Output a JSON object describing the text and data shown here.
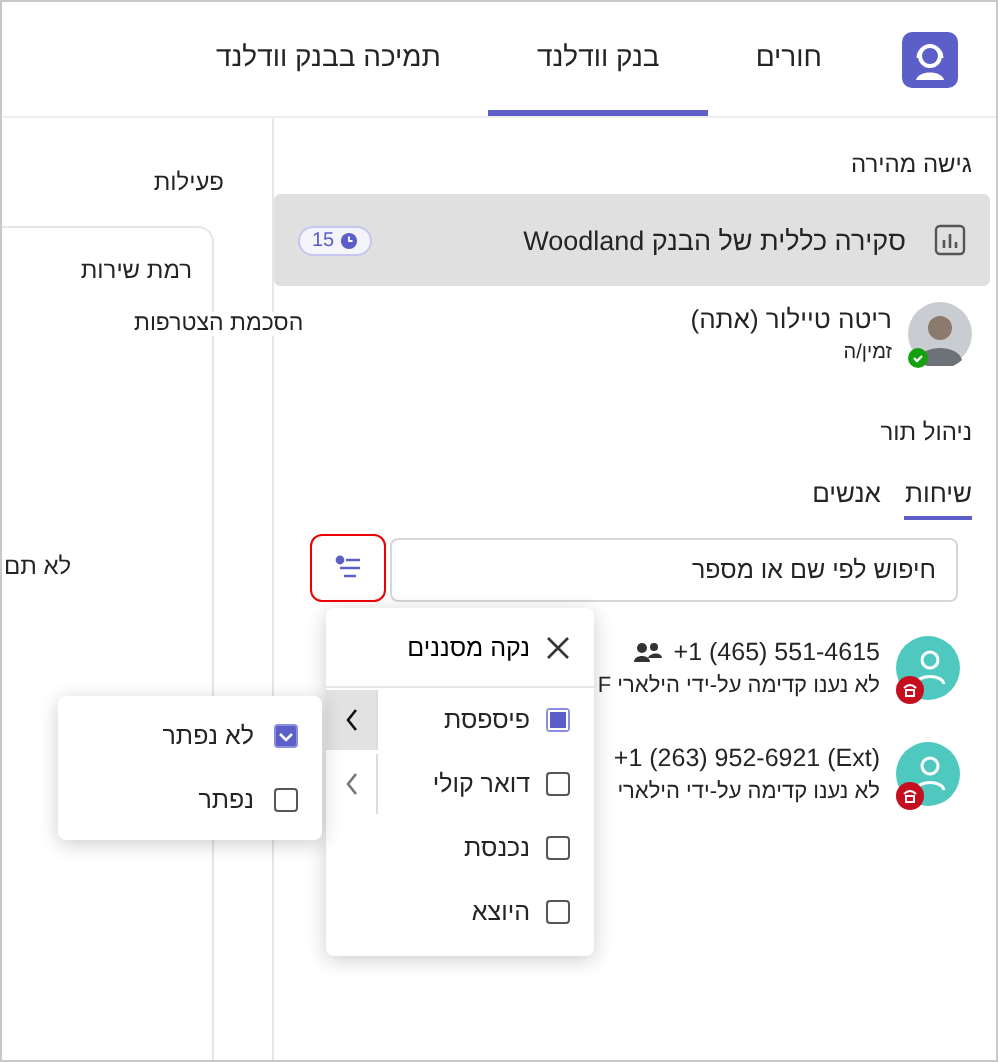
{
  "app_tabs": [
    {
      "label": "חורים",
      "selected": false
    },
    {
      "label": "בנק וודלנד",
      "selected": true
    },
    {
      "label": "תמיכה בבנק וודלנד",
      "selected": false
    }
  ],
  "side": {
    "title": "פעילות",
    "card_title": "רמת שירות",
    "rows": [
      "לא תם"
    ]
  },
  "quick_access": {
    "title": "גישה מהירה",
    "item": "סקירה כללית של הבנק Woodland",
    "badge": "15"
  },
  "user": {
    "name": "ריטה טיילור (אתה)",
    "status": "זמין/ה",
    "link": "הסכמת הצטרפות"
  },
  "queue": {
    "title": "ניהול תור",
    "tabs": [
      {
        "label": "שיחות",
        "selected": true
      },
      {
        "label": "אנשים",
        "selected": false
      }
    ],
    "search": {
      "placeholder": "חיפוש לפי שם או מספר"
    },
    "calls": [
      {
        "number": "+1 (465) 551-4615",
        "note": "לא נענו קדימה על-ידי הילארי F",
        "group": true
      },
      {
        "number": "+1 (263) 952-6921 (Ext)",
        "note": "לא נענו קדימה על-ידי הילארי",
        "group": false
      }
    ]
  },
  "filter_menu": {
    "clear": "נקה מסננים",
    "items": [
      {
        "label": "פיספסת",
        "checked": true,
        "expanded": true
      },
      {
        "label": "דואר קולי",
        "checked": false,
        "expanded": false
      },
      {
        "label": "נכנסת",
        "checked": false
      },
      {
        "label": "היוצא",
        "checked": false
      }
    ]
  },
  "submenu": {
    "items": [
      {
        "label": "לא נפתר",
        "checked": true
      },
      {
        "label": "נפתר",
        "checked": false
      }
    ]
  }
}
